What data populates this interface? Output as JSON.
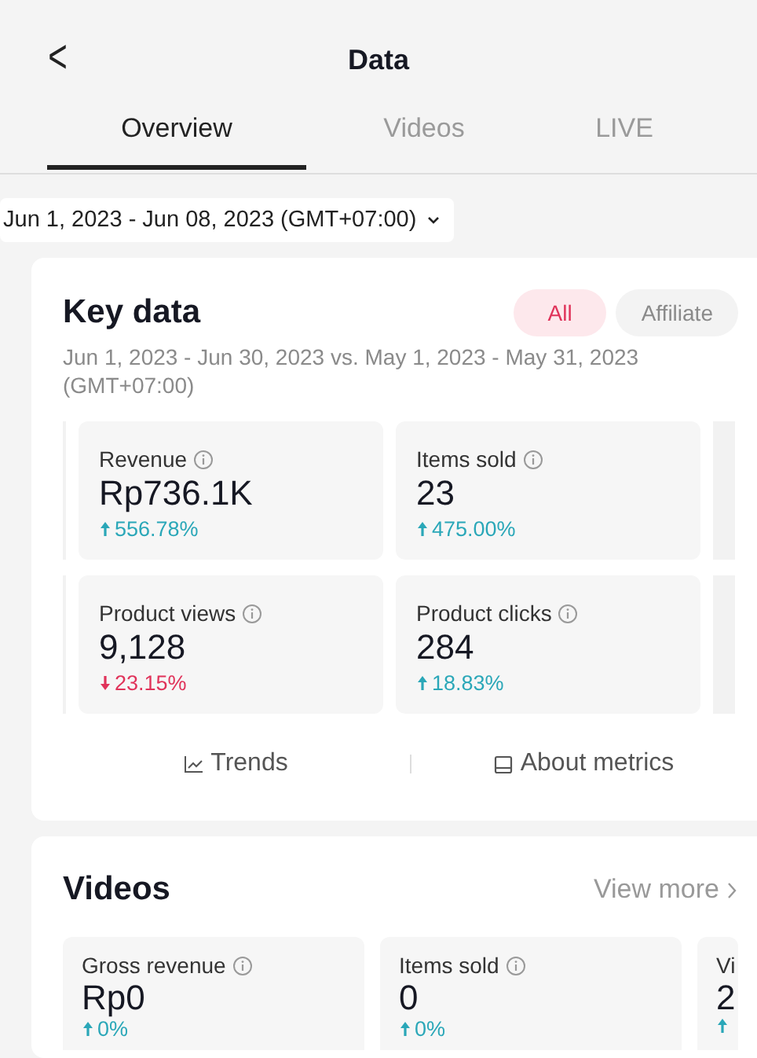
{
  "header": {
    "back": "<",
    "title": "Data"
  },
  "tabs": [
    {
      "label": "Overview",
      "selected": true
    },
    {
      "label": "Videos",
      "selected": false
    },
    {
      "label": "LIVE",
      "selected": false
    }
  ],
  "date_range": "Jun 1, 2023 - Jun 08, 2023 (GMT+07:00)",
  "key_data": {
    "title": "Key data",
    "filters": [
      {
        "label": "All",
        "selected": true
      },
      {
        "label": "Affiliate",
        "selected": false
      }
    ],
    "period": "Jun 1, 2023 - Jun 30, 2023 vs. May 1, 2023 - May 31, 2023 (GMT+07:00)",
    "metrics": [
      {
        "label": "Revenue",
        "value": "Rp736.1K",
        "change": "556.78%",
        "rising": true
      },
      {
        "label": "Items sold",
        "value": "23",
        "change": "475.00%",
        "rising": true
      },
      {
        "label": "Product views",
        "value": "9,128",
        "change": "23.15%",
        "rising": false
      },
      {
        "label": "Product clicks",
        "value": "284",
        "change": "18.83%",
        "rising": true
      }
    ],
    "links": [
      {
        "kind": "trends",
        "label": "Trends"
      },
      {
        "kind": "about",
        "label": "About metrics"
      }
    ]
  },
  "videos": {
    "title": "Videos",
    "more": "View more",
    "metrics": [
      {
        "label": "Gross revenue",
        "value": "Rp0",
        "change": "0%",
        "rising": true
      },
      {
        "label": "Items sold",
        "value": "0",
        "change": "0%",
        "rising": true
      },
      {
        "label": "Vi",
        "value": "2",
        "rising": true
      }
    ]
  }
}
